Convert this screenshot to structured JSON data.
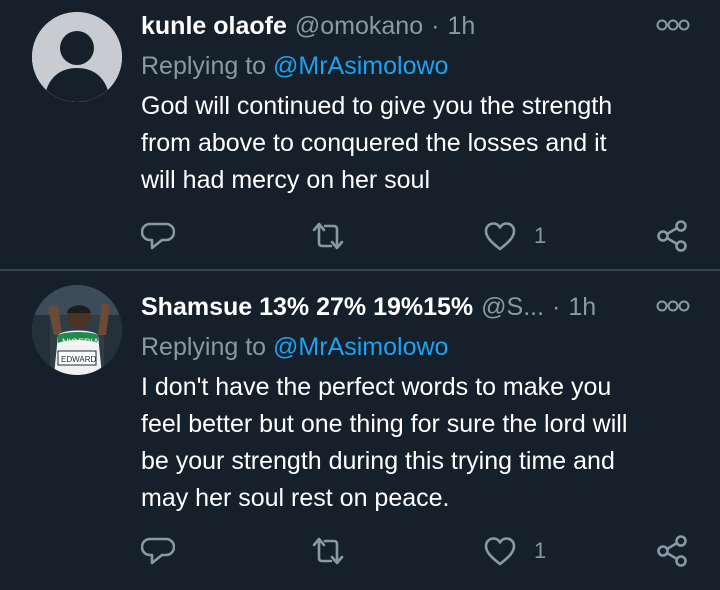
{
  "tweets": [
    {
      "name": "kunle olaofe",
      "handle": "@omokano",
      "separator": "·",
      "time": "1h",
      "replying_prefix": "Replying to",
      "replying_to": "@MrAsimolowo",
      "body_lines": [
        "God will continued to give you the strength",
        "from above to conquered the losses and it",
        "will had mercy on her soul"
      ],
      "like_count": "1"
    },
    {
      "name": "Shamsue 13% 27% 19%15%",
      "handle": "@S...",
      "separator": "·",
      "time": "1h",
      "replying_prefix": "Replying to",
      "replying_to": "@MrAsimolowo",
      "body_lines": [
        "I don't have the perfect words to make you",
        "feel better but one thing for sure the lord will",
        "be your strength during this trying time and",
        "may her soul rest on peace."
      ],
      "avatar_badge_text": "NIGERIA",
      "avatar_bib_text": "EDWARD",
      "like_count": "1"
    }
  ],
  "colors": {
    "background": "#15202b",
    "secondary_text": "#8899a6",
    "link": "#1da1f2",
    "divider": "#38444d"
  },
  "icons": [
    "more-options-icon",
    "reply-icon",
    "retweet-icon",
    "like-icon",
    "share-icon",
    "default-avatar-icon"
  ]
}
